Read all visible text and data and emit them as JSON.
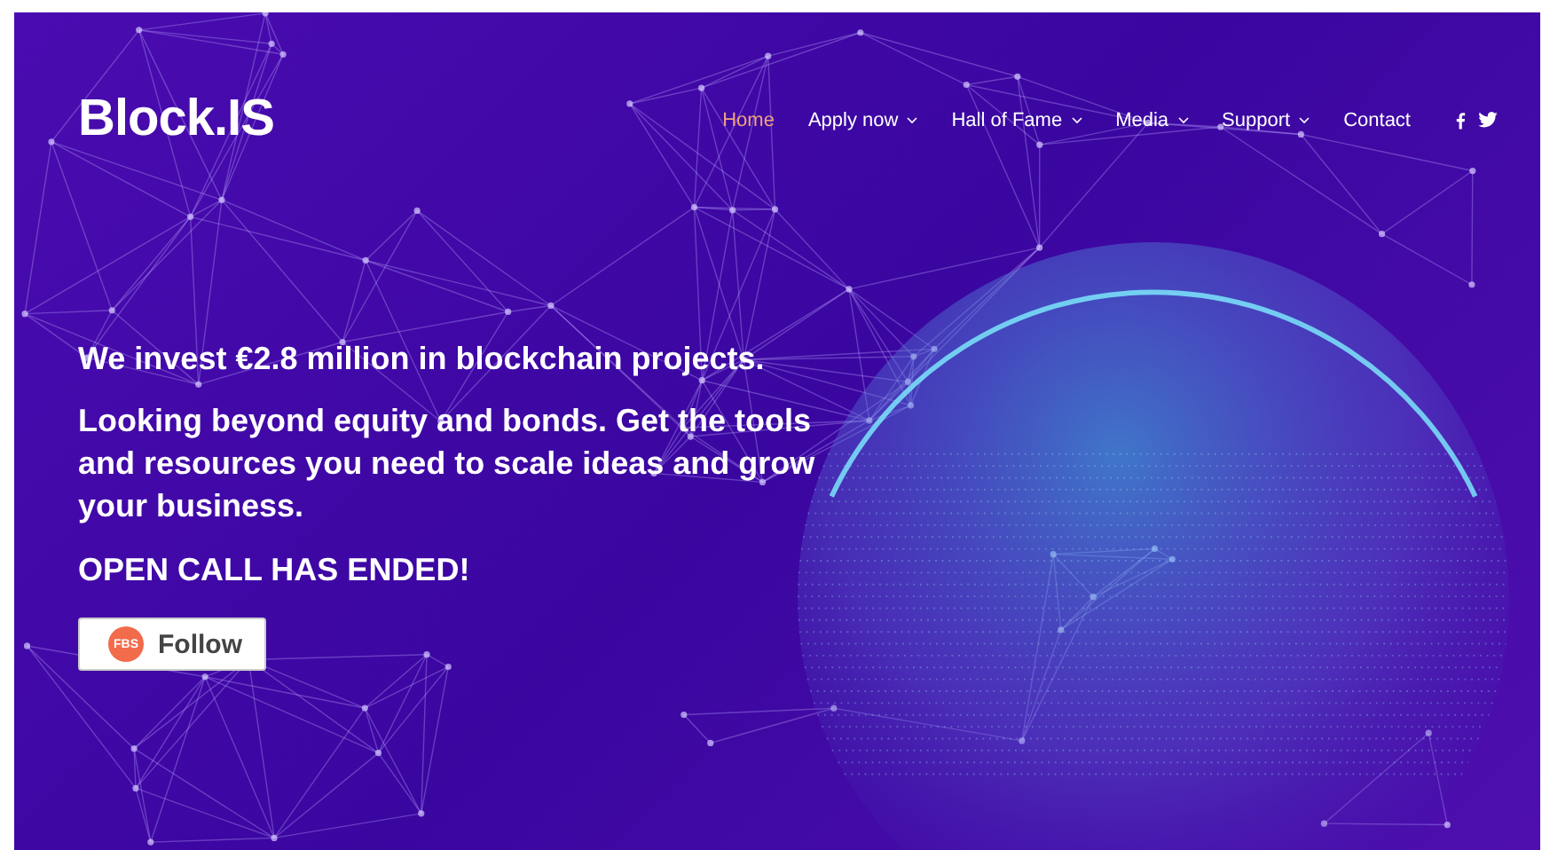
{
  "logo": {
    "text": "Block.IS"
  },
  "nav": [
    {
      "label": "Home",
      "selected": true,
      "dropdown": false
    },
    {
      "label": "Apply now",
      "selected": false,
      "dropdown": true
    },
    {
      "label": "Hall of Fame",
      "selected": false,
      "dropdown": true
    },
    {
      "label": "Media",
      "selected": false,
      "dropdown": true
    },
    {
      "label": "Support",
      "selected": false,
      "dropdown": true
    },
    {
      "label": "Contact",
      "selected": false,
      "dropdown": false
    }
  ],
  "social": [
    {
      "kind": "facebook"
    },
    {
      "kind": "twitter"
    }
  ],
  "hero": {
    "headline": "We invest €2.8 million in blockchain projects.",
    "text": "Looking beyond equity and bonds. Get the tools and resources you need to scale ideas and grow your business.",
    "notice": "OPEN CALL HAS ENDED!"
  },
  "follow_button": {
    "badge": "FBS",
    "label": "Follow"
  }
}
